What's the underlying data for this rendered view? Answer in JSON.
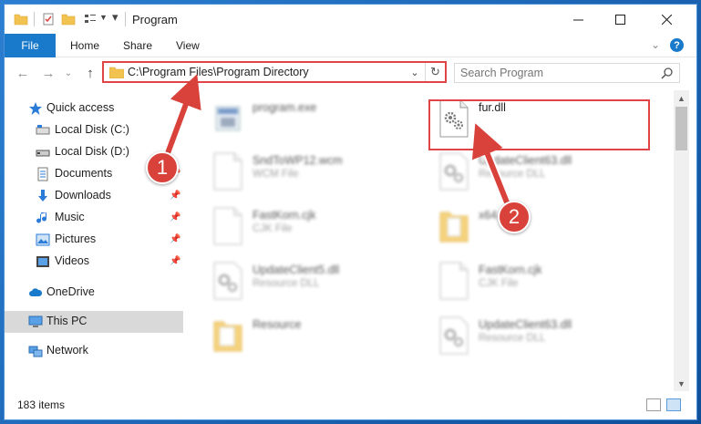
{
  "window": {
    "title": "Program"
  },
  "ribbon": {
    "tabs": [
      {
        "label": "File"
      },
      {
        "label": "Home"
      },
      {
        "label": "Share"
      },
      {
        "label": "View"
      }
    ]
  },
  "address_bar": {
    "path": "C:\\Program Files\\Program Directory"
  },
  "search": {
    "placeholder": "Search Program"
  },
  "sidebar": {
    "items": [
      {
        "label": "Quick access",
        "icon": "star-icon"
      },
      {
        "label": "Local Disk (C:)",
        "icon": "drive-icon"
      },
      {
        "label": "Local Disk (D:)",
        "icon": "drive-icon"
      },
      {
        "label": "Documents",
        "icon": "documents-icon",
        "pinned": true
      },
      {
        "label": "Downloads",
        "icon": "download-arrow-icon",
        "pinned": true
      },
      {
        "label": "Music",
        "icon": "music-note-icon",
        "pinned": true
      },
      {
        "label": "Pictures",
        "icon": "pictures-icon",
        "pinned": true
      },
      {
        "label": "Videos",
        "icon": "videos-icon",
        "pinned": true
      },
      {
        "label": "OneDrive",
        "icon": "cloud-icon"
      },
      {
        "label": "This PC",
        "icon": "monitor-icon",
        "selected": true
      },
      {
        "label": "Network",
        "icon": "network-icon"
      }
    ]
  },
  "files": [
    {
      "name": "program.exe",
      "type": "",
      "icon": "exe-icon",
      "blurred": true
    },
    {
      "name": "fur.dll",
      "type": "",
      "icon": "dll-gear-icon",
      "blurred": false
    },
    {
      "name": "SndToWP12.wcm",
      "type": "WCM File",
      "icon": "blank-file-icon",
      "blurred": true
    },
    {
      "name": "UpdateClient63.dll",
      "type": "Resource DLL",
      "icon": "dll-gear-icon",
      "blurred": true
    },
    {
      "name": "FastKorn.cjk",
      "type": "CJK File",
      "icon": "blank-file-icon",
      "blurred": true
    },
    {
      "name": "x64",
      "type": "",
      "icon": "folder-icon",
      "blurred": true
    },
    {
      "name": "UpdateClient5.dll",
      "type": "Resource DLL",
      "icon": "dll-gear-icon",
      "blurred": true
    },
    {
      "name": "FastKorn.cjk",
      "type": "CJK File",
      "icon": "blank-file-icon",
      "blurred": true
    },
    {
      "name": "Resource",
      "type": "",
      "icon": "folder-icon",
      "blurred": true
    },
    {
      "name": "UpdateClient63.dll",
      "type": "Resource DLL",
      "icon": "dll-gear-icon",
      "blurred": true
    }
  ],
  "status": {
    "item_count": "183 items"
  },
  "annotations": [
    {
      "label": "1",
      "color": "#d9413b"
    },
    {
      "label": "2",
      "color": "#d9413b"
    }
  ],
  "colors": {
    "accent": "#1979ca",
    "highlight": "#e04444"
  }
}
